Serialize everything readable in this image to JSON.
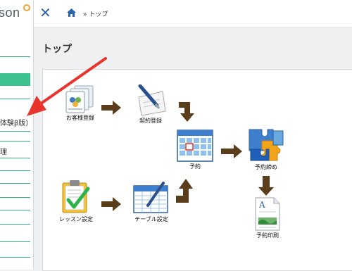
{
  "app": {
    "logo_text": "son"
  },
  "topbar": {
    "close_icon": "close-x-icon",
    "home_icon": "home-icon",
    "breadcrumb": "» トップ"
  },
  "sidebar": {
    "items": [
      {
        "label": "(体験β版)"
      },
      {
        "label": "理"
      }
    ]
  },
  "page": {
    "title": "トップ"
  },
  "workflow": {
    "nodes": {
      "customer": "お客様登録",
      "contract": "契約登録",
      "reservation": "予約",
      "close": "予約締め",
      "print": "予約印刷",
      "lesson": "レッスン設定",
      "table": "テーブル設定"
    }
  },
  "colors": {
    "accent_green": "#3cc08e",
    "arrow_brown": "#5a3d1a",
    "pointer_red": "#e8342c",
    "brand_blue": "#2a64a9"
  }
}
